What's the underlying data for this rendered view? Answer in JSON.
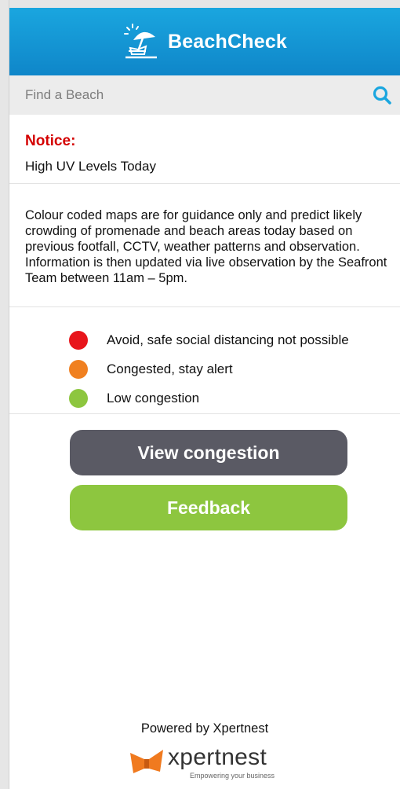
{
  "app": {
    "title": "BeachCheck",
    "brand_color": "#1aa6df"
  },
  "search": {
    "placeholder": "Find a Beach",
    "value": "",
    "icon": "search-icon"
  },
  "notice": {
    "title": "Notice:",
    "text": "High UV Levels Today",
    "title_color": "#d40000"
  },
  "info": {
    "text": "Colour coded maps are for guidance only and predict likely crowding of promenade and beach areas today based on previous footfall, CCTV, weather patterns and observation. Information is then updated via live observation by the Seafront Team between 11am – 5pm."
  },
  "legend": [
    {
      "label": "Avoid, safe social distancing not possible",
      "color": "#e8151b"
    },
    {
      "label": "Congested, stay alert",
      "color": "#f08020"
    },
    {
      "label": "Low congestion",
      "color": "#8dc63f"
    }
  ],
  "buttons": {
    "view_congestion": "View congestion",
    "feedback": "Feedback",
    "view_congestion_color": "#5a5a64",
    "feedback_color": "#8dc63f"
  },
  "footer": {
    "powered_by": "Powered by Xpertnest",
    "brand_name": "xpertnest",
    "tagline": "Empowering your business",
    "brand_mark_color": "#f07a1f"
  }
}
